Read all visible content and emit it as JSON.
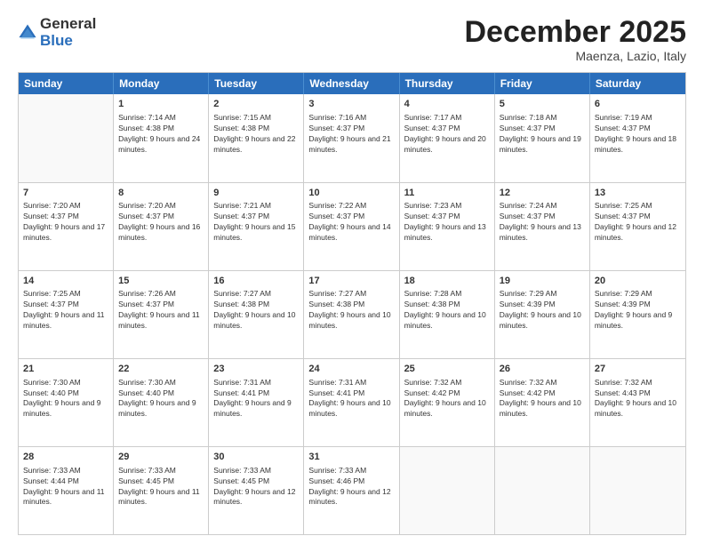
{
  "logo": {
    "general": "General",
    "blue": "Blue"
  },
  "title": "December 2025",
  "subtitle": "Maenza, Lazio, Italy",
  "header_days": [
    "Sunday",
    "Monday",
    "Tuesday",
    "Wednesday",
    "Thursday",
    "Friday",
    "Saturday"
  ],
  "weeks": [
    [
      {
        "day": "",
        "sunrise": "",
        "sunset": "",
        "daylight": ""
      },
      {
        "day": "1",
        "sunrise": "Sunrise: 7:14 AM",
        "sunset": "Sunset: 4:38 PM",
        "daylight": "Daylight: 9 hours and 24 minutes."
      },
      {
        "day": "2",
        "sunrise": "Sunrise: 7:15 AM",
        "sunset": "Sunset: 4:38 PM",
        "daylight": "Daylight: 9 hours and 22 minutes."
      },
      {
        "day": "3",
        "sunrise": "Sunrise: 7:16 AM",
        "sunset": "Sunset: 4:37 PM",
        "daylight": "Daylight: 9 hours and 21 minutes."
      },
      {
        "day": "4",
        "sunrise": "Sunrise: 7:17 AM",
        "sunset": "Sunset: 4:37 PM",
        "daylight": "Daylight: 9 hours and 20 minutes."
      },
      {
        "day": "5",
        "sunrise": "Sunrise: 7:18 AM",
        "sunset": "Sunset: 4:37 PM",
        "daylight": "Daylight: 9 hours and 19 minutes."
      },
      {
        "day": "6",
        "sunrise": "Sunrise: 7:19 AM",
        "sunset": "Sunset: 4:37 PM",
        "daylight": "Daylight: 9 hours and 18 minutes."
      }
    ],
    [
      {
        "day": "7",
        "sunrise": "Sunrise: 7:20 AM",
        "sunset": "Sunset: 4:37 PM",
        "daylight": "Daylight: 9 hours and 17 minutes."
      },
      {
        "day": "8",
        "sunrise": "Sunrise: 7:20 AM",
        "sunset": "Sunset: 4:37 PM",
        "daylight": "Daylight: 9 hours and 16 minutes."
      },
      {
        "day": "9",
        "sunrise": "Sunrise: 7:21 AM",
        "sunset": "Sunset: 4:37 PM",
        "daylight": "Daylight: 9 hours and 15 minutes."
      },
      {
        "day": "10",
        "sunrise": "Sunrise: 7:22 AM",
        "sunset": "Sunset: 4:37 PM",
        "daylight": "Daylight: 9 hours and 14 minutes."
      },
      {
        "day": "11",
        "sunrise": "Sunrise: 7:23 AM",
        "sunset": "Sunset: 4:37 PM",
        "daylight": "Daylight: 9 hours and 13 minutes."
      },
      {
        "day": "12",
        "sunrise": "Sunrise: 7:24 AM",
        "sunset": "Sunset: 4:37 PM",
        "daylight": "Daylight: 9 hours and 13 minutes."
      },
      {
        "day": "13",
        "sunrise": "Sunrise: 7:25 AM",
        "sunset": "Sunset: 4:37 PM",
        "daylight": "Daylight: 9 hours and 12 minutes."
      }
    ],
    [
      {
        "day": "14",
        "sunrise": "Sunrise: 7:25 AM",
        "sunset": "Sunset: 4:37 PM",
        "daylight": "Daylight: 9 hours and 11 minutes."
      },
      {
        "day": "15",
        "sunrise": "Sunrise: 7:26 AM",
        "sunset": "Sunset: 4:37 PM",
        "daylight": "Daylight: 9 hours and 11 minutes."
      },
      {
        "day": "16",
        "sunrise": "Sunrise: 7:27 AM",
        "sunset": "Sunset: 4:38 PM",
        "daylight": "Daylight: 9 hours and 10 minutes."
      },
      {
        "day": "17",
        "sunrise": "Sunrise: 7:27 AM",
        "sunset": "Sunset: 4:38 PM",
        "daylight": "Daylight: 9 hours and 10 minutes."
      },
      {
        "day": "18",
        "sunrise": "Sunrise: 7:28 AM",
        "sunset": "Sunset: 4:38 PM",
        "daylight": "Daylight: 9 hours and 10 minutes."
      },
      {
        "day": "19",
        "sunrise": "Sunrise: 7:29 AM",
        "sunset": "Sunset: 4:39 PM",
        "daylight": "Daylight: 9 hours and 10 minutes."
      },
      {
        "day": "20",
        "sunrise": "Sunrise: 7:29 AM",
        "sunset": "Sunset: 4:39 PM",
        "daylight": "Daylight: 9 hours and 9 minutes."
      }
    ],
    [
      {
        "day": "21",
        "sunrise": "Sunrise: 7:30 AM",
        "sunset": "Sunset: 4:40 PM",
        "daylight": "Daylight: 9 hours and 9 minutes."
      },
      {
        "day": "22",
        "sunrise": "Sunrise: 7:30 AM",
        "sunset": "Sunset: 4:40 PM",
        "daylight": "Daylight: 9 hours and 9 minutes."
      },
      {
        "day": "23",
        "sunrise": "Sunrise: 7:31 AM",
        "sunset": "Sunset: 4:41 PM",
        "daylight": "Daylight: 9 hours and 9 minutes."
      },
      {
        "day": "24",
        "sunrise": "Sunrise: 7:31 AM",
        "sunset": "Sunset: 4:41 PM",
        "daylight": "Daylight: 9 hours and 10 minutes."
      },
      {
        "day": "25",
        "sunrise": "Sunrise: 7:32 AM",
        "sunset": "Sunset: 4:42 PM",
        "daylight": "Daylight: 9 hours and 10 minutes."
      },
      {
        "day": "26",
        "sunrise": "Sunrise: 7:32 AM",
        "sunset": "Sunset: 4:42 PM",
        "daylight": "Daylight: 9 hours and 10 minutes."
      },
      {
        "day": "27",
        "sunrise": "Sunrise: 7:32 AM",
        "sunset": "Sunset: 4:43 PM",
        "daylight": "Daylight: 9 hours and 10 minutes."
      }
    ],
    [
      {
        "day": "28",
        "sunrise": "Sunrise: 7:33 AM",
        "sunset": "Sunset: 4:44 PM",
        "daylight": "Daylight: 9 hours and 11 minutes."
      },
      {
        "day": "29",
        "sunrise": "Sunrise: 7:33 AM",
        "sunset": "Sunset: 4:45 PM",
        "daylight": "Daylight: 9 hours and 11 minutes."
      },
      {
        "day": "30",
        "sunrise": "Sunrise: 7:33 AM",
        "sunset": "Sunset: 4:45 PM",
        "daylight": "Daylight: 9 hours and 12 minutes."
      },
      {
        "day": "31",
        "sunrise": "Sunrise: 7:33 AM",
        "sunset": "Sunset: 4:46 PM",
        "daylight": "Daylight: 9 hours and 12 minutes."
      },
      {
        "day": "",
        "sunrise": "",
        "sunset": "",
        "daylight": ""
      },
      {
        "day": "",
        "sunrise": "",
        "sunset": "",
        "daylight": ""
      },
      {
        "day": "",
        "sunrise": "",
        "sunset": "",
        "daylight": ""
      }
    ]
  ]
}
